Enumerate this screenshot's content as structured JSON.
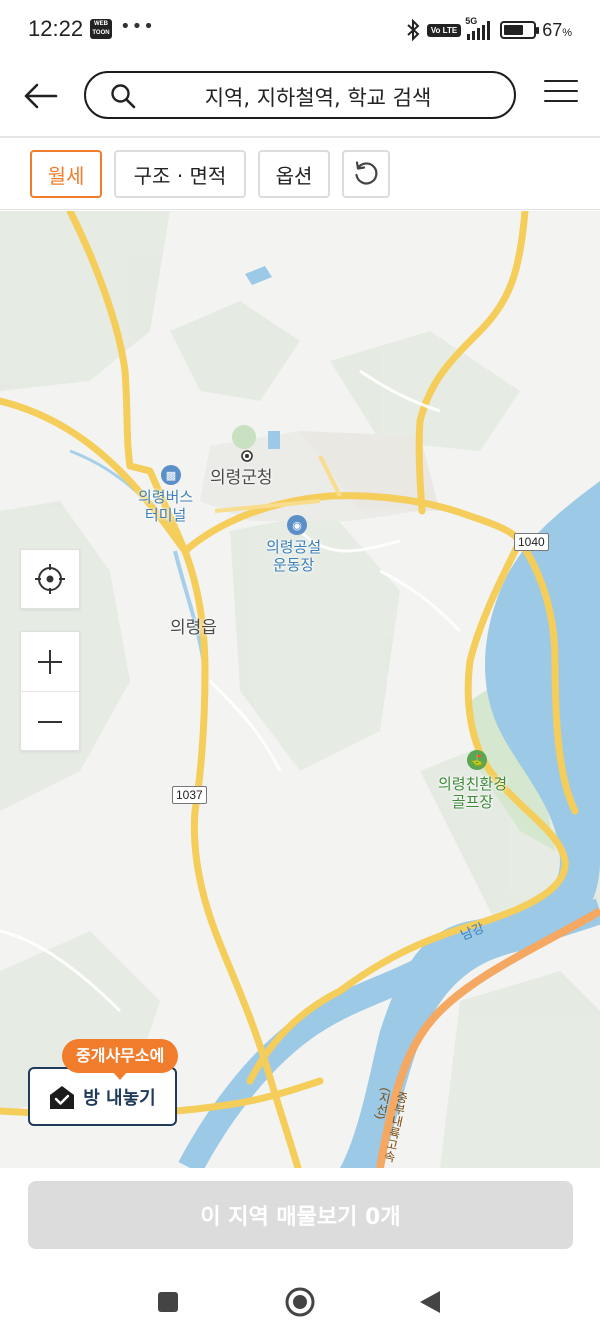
{
  "status_bar": {
    "time": "12:22",
    "webtoon_badge": "WEB TOON",
    "more": "•••",
    "network": "5G",
    "volte": "Vo LTE",
    "battery_level": 0.67,
    "battery_percent": "67",
    "percent_sign": "%"
  },
  "header": {
    "search_placeholder": "지역, 지하철역, 학교 검색"
  },
  "filters": {
    "monthly_rent": "월세",
    "structure_area": "구조 · 면적",
    "options": "옵션"
  },
  "map": {
    "labels": {
      "county_office": "의령군청",
      "bus_terminal": "의령버스\n터미널",
      "stadium": "의령공설\n운동장",
      "town": "의령읍",
      "golf": "의령친환경\n골프장",
      "river": "남강",
      "highway": "중부내륙고속(지선)"
    },
    "road_shields": {
      "r1040": "1040",
      "r1037": "1037"
    },
    "colors": {
      "road": "#f5cd5a",
      "highway": "#f4a862",
      "river": "#9cc9e6",
      "forest": "#dfe8dc",
      "accent": "#f07c2c"
    }
  },
  "promo": {
    "bubble": "중개사무소에",
    "button": "방 내놓기"
  },
  "bottom": {
    "view_listings": "이 지역 매물보기 0개"
  }
}
